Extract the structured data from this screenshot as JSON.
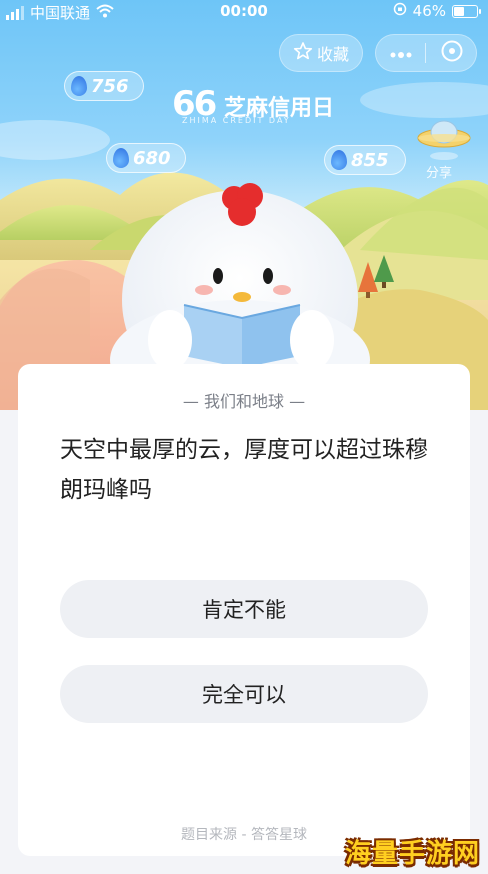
{
  "status_bar": {
    "carrier": "中国联通",
    "time": "00:00",
    "battery": "46%",
    "battery_level": 0.46,
    "icons": [
      "signal-icon",
      "wifi-icon",
      "orientation-lock-icon",
      "battery-icon"
    ]
  },
  "header": {
    "collect_label": "收藏",
    "more_icon": "more-icon",
    "close_icon": "close-icon",
    "star_icon": "star-icon"
  },
  "energy": [
    {
      "value": "756"
    },
    {
      "value": "680"
    },
    {
      "value": "855"
    }
  ],
  "logo": {
    "number": "66",
    "title": "芝麻信用日",
    "subtitle": "ZHIMA CREDIT DAY"
  },
  "share": {
    "label": "分享"
  },
  "quiz": {
    "category": "我们和地球",
    "question": "天空中最厚的云，厚度可以超过珠穆朗玛峰吗",
    "options": [
      {
        "label": "肯定不能"
      },
      {
        "label": "完全可以"
      }
    ],
    "source": "题目来源 - 答答星球"
  },
  "watermark": "海量手游网",
  "colors": {
    "sky": "#6ec5f7",
    "card": "#ffffff",
    "option_bg": "#eef0f4",
    "text": "#222222",
    "muted": "#7b7f88"
  }
}
